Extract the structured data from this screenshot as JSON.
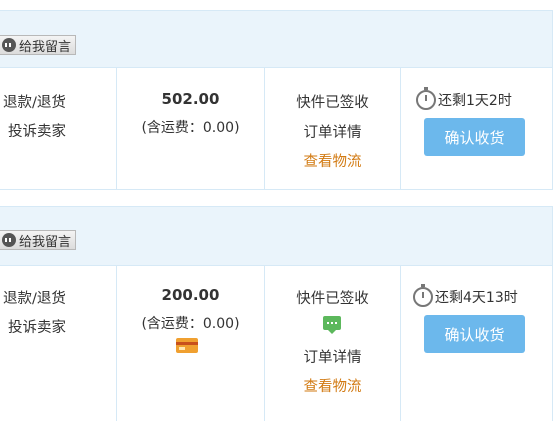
{
  "orders": [
    {
      "message_button": "给我留言",
      "refund_link": "退款/退货",
      "complaint_link": "投诉卖家",
      "price": "502.00",
      "shipping_note": "(含运费：0.00)",
      "status_text": "快件已签收",
      "detail_link": "订单详情",
      "logistics_link": "查看物流",
      "time_remaining": "还剩1天2时",
      "confirm_button": "确认收货"
    },
    {
      "message_button": "给我留言",
      "refund_link": "退款/退货",
      "complaint_link": "投诉卖家",
      "price": "200.00",
      "shipping_note": "(含运费：0.00)",
      "status_text": "快件已签收",
      "detail_link": "订单详情",
      "logistics_link": "查看物流",
      "time_remaining": "还剩4天13时",
      "confirm_button": "确认收货"
    }
  ],
  "icons": {
    "message_button_icon": "speech-bubble-icon",
    "timer_icon": "stopwatch-icon",
    "chat_icon": "chat-icon",
    "card_icon": "credit-card-icon"
  },
  "colors": {
    "header_bg": "#eaf4fb",
    "border": "#d6e9f6",
    "confirm_button": "#6cb8ec",
    "logistics_link": "#d27a12",
    "chat_icon": "#5cb85c",
    "card_icon": "#f0a030"
  }
}
